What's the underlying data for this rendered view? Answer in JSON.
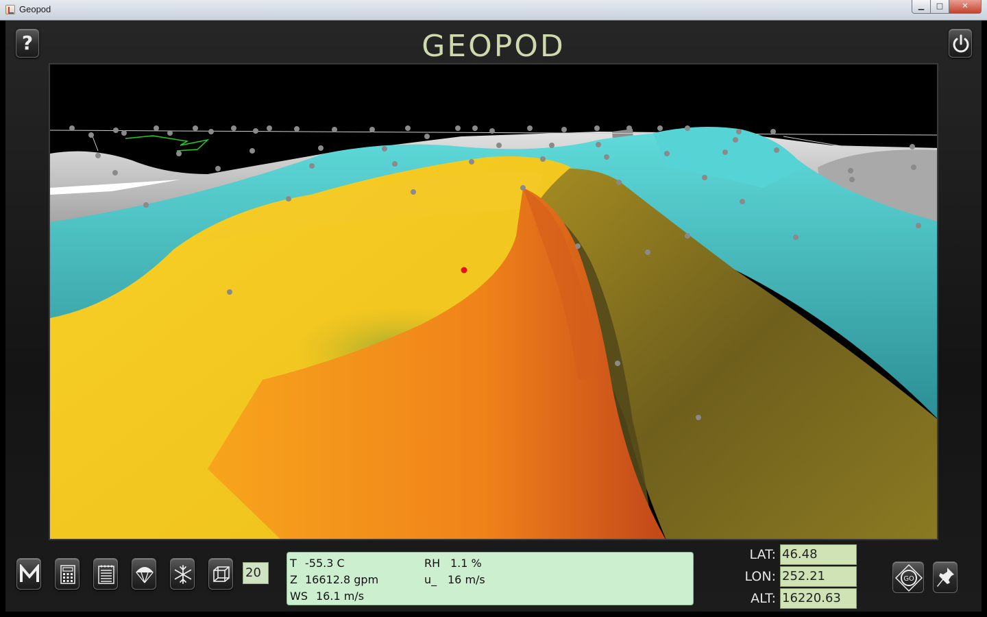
{
  "window": {
    "title": "Geopod",
    "minimize_glyph": "▁",
    "maximize_glyph": "□",
    "close_glyph": "✕"
  },
  "app": {
    "title": "GEOPOD",
    "help_glyph": "?"
  },
  "toolbar": {
    "icons": [
      "menu-m-icon",
      "calculator-icon",
      "notepad-icon",
      "parachute-icon",
      "snowflake-icon",
      "cube-icon"
    ],
    "count_value": "20"
  },
  "readout": {
    "t_label": "T",
    "t_value": "-55.3 C",
    "z_label": "Z",
    "z_value": "16612.8 gpm",
    "ws_label": "WS",
    "ws_value": "16.1 m/s",
    "rh_label": "RH",
    "rh_value": "1.1 %",
    "u_label": "u_",
    "u_value": "16 m/s"
  },
  "position": {
    "lat_label": "LAT:",
    "lat_value": "46.48",
    "lon_label": "LON:",
    "lon_value": "252.21",
    "alt_label": "ALT:",
    "alt_value": "16220.63"
  },
  "go_label": "GO",
  "colors": {
    "title": "#cfd9ae",
    "surface_yellow": "#f5c81d",
    "surface_orange": "#f08a1a",
    "surface_cyan": "#4cc9cc",
    "surface_olive": "#8f7f1e",
    "terrain_gray": "#bdbdbd",
    "field_green": "#cfe3b5",
    "readout_green": "#ccf0cf"
  }
}
